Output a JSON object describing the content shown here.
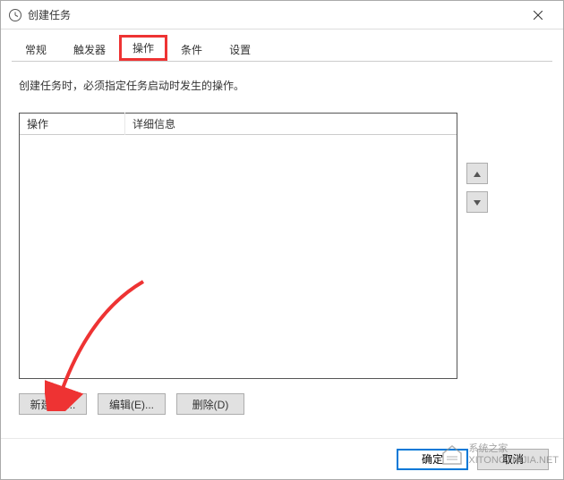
{
  "window": {
    "title": "创建任务"
  },
  "tabs": {
    "items": [
      {
        "label": "常规"
      },
      {
        "label": "触发器"
      },
      {
        "label": "操作"
      },
      {
        "label": "条件"
      },
      {
        "label": "设置"
      }
    ],
    "active_index": 2
  },
  "panel": {
    "instruction": "创建任务时，必须指定任务启动时发生的操作。",
    "columns": {
      "operation": "操作",
      "detail": "详细信息"
    }
  },
  "buttons": {
    "new": "新建(N)...",
    "edit": "编辑(E)...",
    "delete": "删除(D)",
    "ok": "确定",
    "cancel": "取消"
  },
  "watermark": {
    "line1": "系统之家",
    "line2": "XITONGZHIJIA.NET"
  }
}
